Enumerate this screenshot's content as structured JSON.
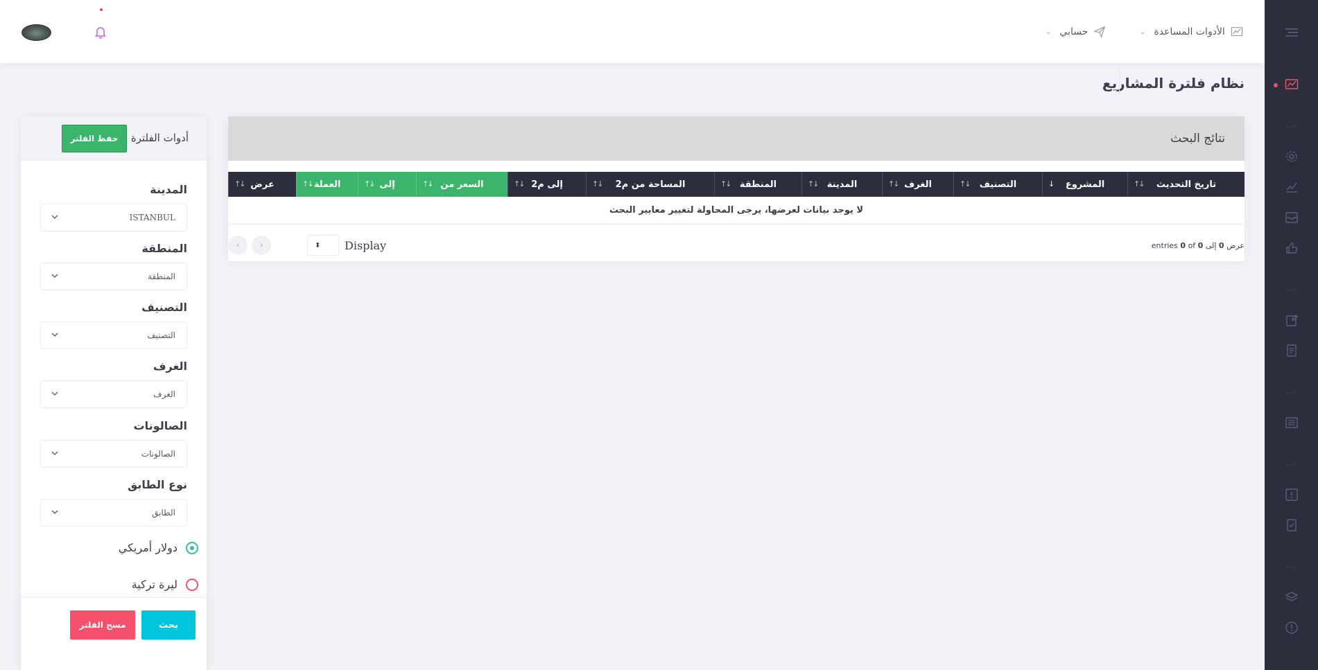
{
  "topbar": {
    "tools_menu_label": "الأدوات المساعدة",
    "account_menu_label": "حسابي"
  },
  "page": {
    "title": "نظام فلترة المشاريع"
  },
  "results": {
    "title": "نتائج البحث",
    "columns": [
      "تاريخ التحديث",
      "المشروع",
      "التصنيف",
      "الغرف",
      "المدينة",
      "المنطقة",
      "المساحة من م2",
      "إلى م2",
      "السعر من",
      "إلى",
      "العملة",
      "عرض"
    ],
    "no_data_message": "لا يوجد بيانات لعرضها، يرجى المحاولة لتغيير معايير البحث",
    "info": {
      "prefix": "عرض",
      "from": "0",
      "to_word": "إلى",
      "to": "0",
      "entries_word": "entries",
      "of_word": "of",
      "total": "0"
    },
    "display_label": "Display"
  },
  "filter": {
    "title": "أدوات الفلترة",
    "save_label": "حفظ الفلتر",
    "fields": [
      {
        "label": "المدينة",
        "value": "ISTANBUL"
      },
      {
        "label": "المنطقة",
        "value": "المنطقة"
      },
      {
        "label": "التصنيف",
        "value": "التصنيف"
      },
      {
        "label": "الغرف",
        "value": "الغرف"
      },
      {
        "label": "الصالونات",
        "value": "الصالونات"
      },
      {
        "label": "نوع الطابق",
        "value": "الطابق"
      }
    ],
    "currencies": [
      {
        "label": "دولار أمريكي",
        "selected": true
      },
      {
        "label": "ليرة تركية",
        "selected": false
      }
    ],
    "search_label": "بحث",
    "clear_label": "مسح الفلتر"
  },
  "colors": {
    "sidebar_bg": "#2c2e3e",
    "header_dark": "#2c2e3e",
    "green": "#3ab56b",
    "cyan": "#00c5dc",
    "danger": "#f4516c",
    "active_icon": "#f4516c"
  },
  "icons": {
    "sidebar": [
      "hamburger-icon",
      "chart-line-icon",
      "gear-icon",
      "trend-icon",
      "inbox-icon",
      "thumb-up-icon",
      "clipboard-icon",
      "document-icon",
      "list-icon",
      "alert-box-icon",
      "checklist-icon",
      "layers-icon",
      "alert-circle-icon"
    ],
    "topbar": [
      "bell-icon",
      "paper-plane-icon",
      "chart-icon",
      "chevron-down-icon"
    ]
  }
}
